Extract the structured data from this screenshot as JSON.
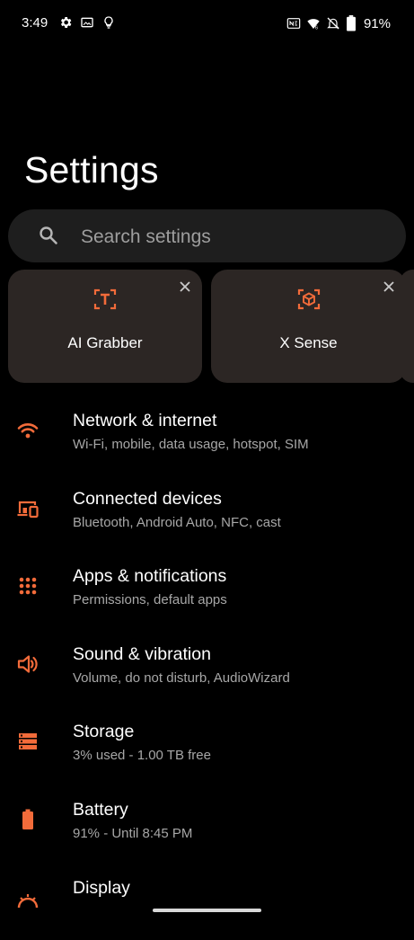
{
  "status_bar": {
    "time": "3:49",
    "battery": "91%",
    "left_icons": [
      "gear-icon",
      "image-icon",
      "lightbulb-icon"
    ],
    "right_icons": [
      "nfc-icon",
      "wifi-icon",
      "mute-icon",
      "battery-icon"
    ]
  },
  "page": {
    "title": "Settings"
  },
  "search": {
    "placeholder": "Search settings"
  },
  "cards": [
    {
      "label": "AI Grabber",
      "icon": "ai-grabber-icon"
    },
    {
      "label": "X Sense",
      "icon": "x-sense-icon"
    }
  ],
  "settings": [
    {
      "title": "Network & internet",
      "subtitle": "Wi-Fi, mobile, data usage, hotspot, SIM",
      "icon": "wifi-icon"
    },
    {
      "title": "Connected devices",
      "subtitle": "Bluetooth, Android Auto, NFC, cast",
      "icon": "devices-icon"
    },
    {
      "title": "Apps & notifications",
      "subtitle": "Permissions, default apps",
      "icon": "apps-grid-icon"
    },
    {
      "title": "Sound & vibration",
      "subtitle": "Volume, do not disturb, AudioWizard",
      "icon": "speaker-icon"
    },
    {
      "title": "Storage",
      "subtitle": "3% used - 1.00 TB free",
      "icon": "storage-icon"
    },
    {
      "title": "Battery",
      "subtitle": "91% - Until 8:45 PM",
      "icon": "battery-icon"
    },
    {
      "title": "Display",
      "subtitle": "",
      "icon": "display-icon"
    }
  ],
  "colors": {
    "accent": "#f26b3a",
    "background": "#000000",
    "card": "#2c2624",
    "search_bg": "#1e1e1e",
    "subtitle": "#a7a7a7"
  }
}
